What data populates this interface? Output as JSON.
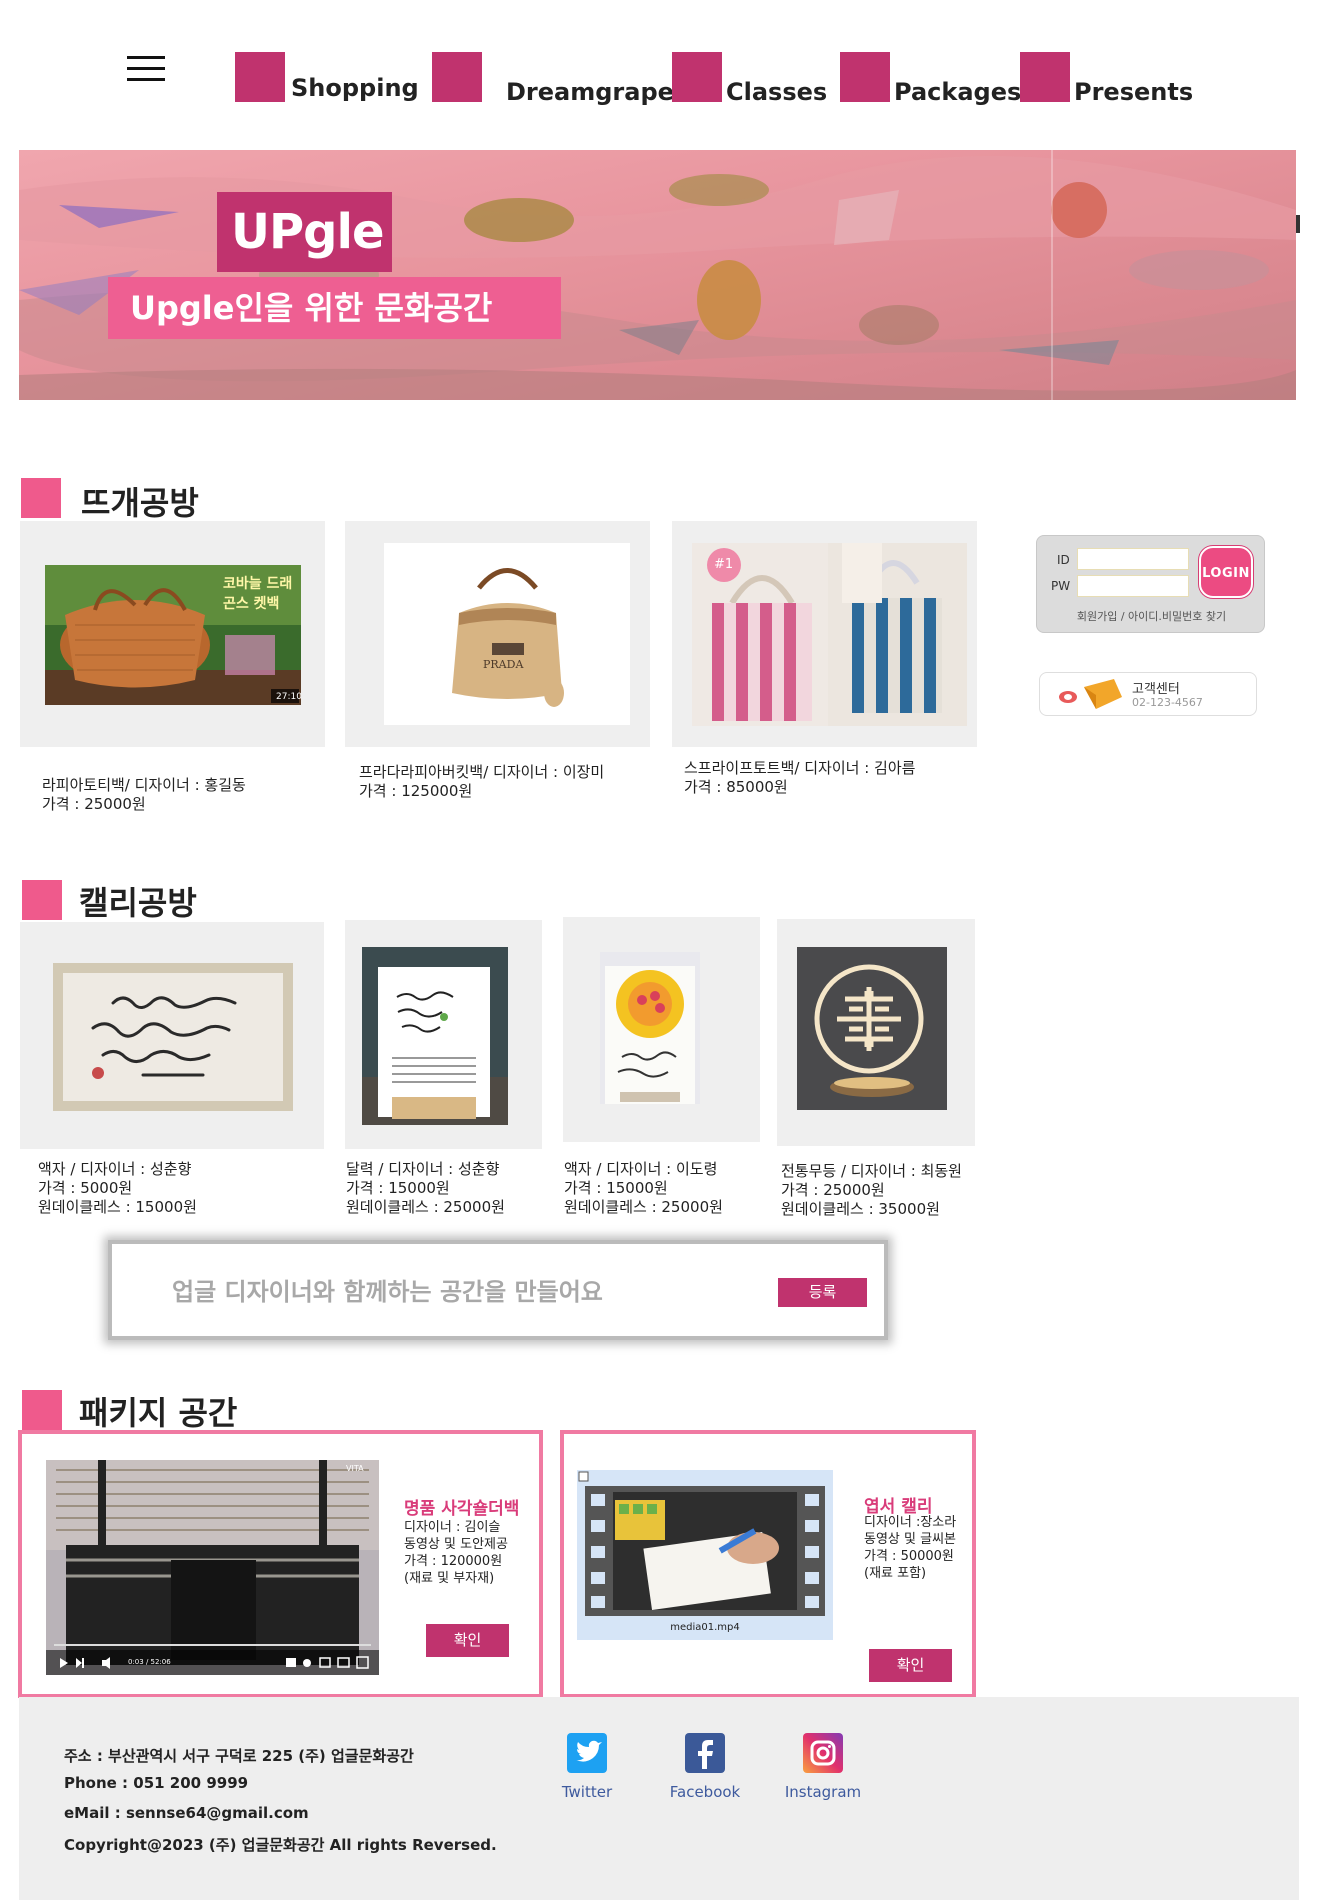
{
  "nav": {
    "items": [
      {
        "label": "Shopping"
      },
      {
        "label": "Dreamgraper"
      },
      {
        "label": "Classes"
      },
      {
        "label": "Packages"
      },
      {
        "label": "Presents"
      }
    ]
  },
  "banner": {
    "logo": "UPgle",
    "tagline": "Upgle인을 위한 문화공간"
  },
  "section_knit": {
    "title": "뜨개공방",
    "items": [
      {
        "line1": "라피아토티백/ 디자이너 : 홍길동",
        "line2": "가격 : 25000원",
        "overlay": "코바늘 드래곤스 켓백",
        "duration": "27:10"
      },
      {
        "line1": "프라다라피아버킷백/ 디자이너 : 이장미",
        "line2": "가격 : 125000원",
        "brand": "PRADA"
      },
      {
        "line1": "스프라이프토트백/ 디자이너 : 김아름",
        "line2": "가격 : 85000원",
        "badge": "#1"
      }
    ]
  },
  "login": {
    "id_label": "ID",
    "pw_label": "PW",
    "button": "LOGIN",
    "links": "회원가입 / 아이디.비밀번호 찾기"
  },
  "customer_center": {
    "title": "고객센터",
    "phone": "02-123-4567"
  },
  "section_calli": {
    "title": "캘리공방",
    "items": [
      {
        "line1": "액자 / 디자이너 : 성춘향",
        "line2": "가격 : 5000원",
        "line3": "원데이클레스 : 15000원"
      },
      {
        "line1": "달력 / 디자이너 : 성춘향",
        "line2": "가격 : 15000원",
        "line3": "원데이클레스 : 25000원"
      },
      {
        "line1": "액자 / 디자이너 : 이도령",
        "line2": "가격 : 15000원",
        "line3": "원데이클레스 : 25000원"
      },
      {
        "line1": "전통무등 / 디자이너 : 최동원",
        "line2": "가격 : 25000원",
        "line3": "원데이클레스 : 35000원"
      }
    ]
  },
  "register": {
    "placeholder": "업글 디자이너와 함께하는 공간을 만들어요",
    "button": "등록"
  },
  "section_package": {
    "title": "패키지 공간",
    "items": [
      {
        "title": "명품 사각숄더백",
        "lines": [
          "디자이너 : 김이슬",
          "동영상 및 도안제공",
          "가격 : 120000원",
          "(재료 및 부자재)"
        ],
        "button": "확인",
        "video_time": "0:03 / 52:06",
        "watermark": "VITA"
      },
      {
        "title": "엽서 캘리",
        "lines": [
          "디자이너 :장소라",
          "동영상 및 글씨본",
          "가격 : 50000원",
          "(재료 포함)"
        ],
        "button": "확인",
        "file": "media01.mp4"
      }
    ]
  },
  "footer": {
    "address": "주소 : 부산관역시 서구 구덕로 225 (주) 업글문화공간",
    "phone": "Phone : 051 200 9999",
    "email": "eMail : sennse64@gmail.com",
    "copyright": "Copyright@2023 (주) 업글문화공간 All rights Reversed.",
    "social": [
      {
        "name": "Twitter",
        "icon": "twitter-icon",
        "color": "#1da1f2"
      },
      {
        "name": "Facebook",
        "icon": "facebook-icon",
        "color": "#3b5998"
      },
      {
        "name": "Instagram",
        "icon": "instagram-icon",
        "color": "#d6249f"
      }
    ]
  },
  "colors": {
    "accent": "#c0336e",
    "pink": "#ef5a8c",
    "package_border": "#f07aa2"
  }
}
